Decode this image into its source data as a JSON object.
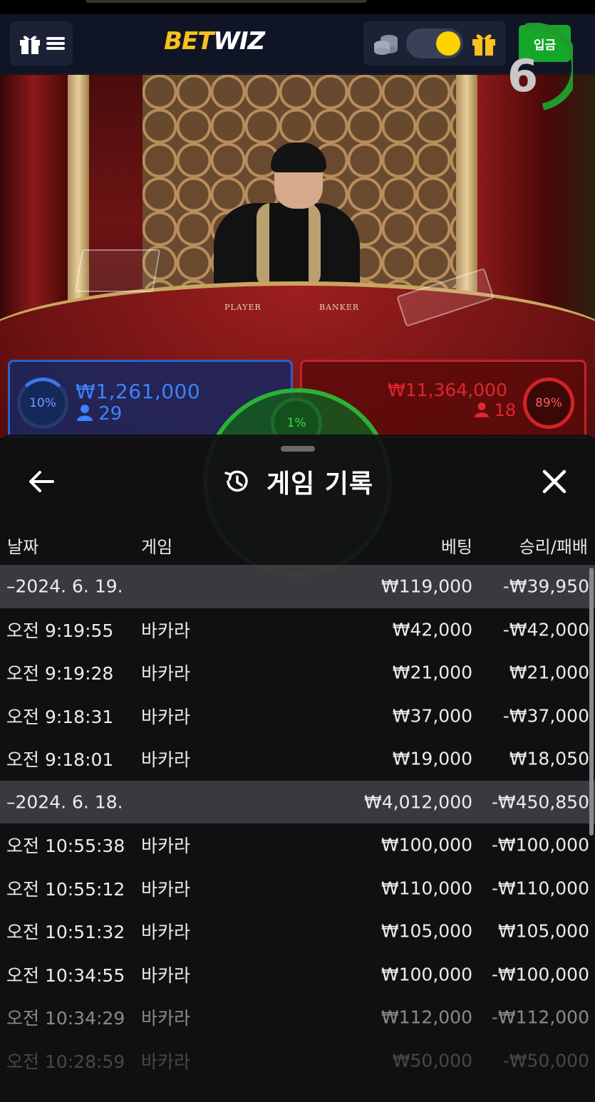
{
  "header": {
    "logo_part1": "BET",
    "logo_part2": "WIZ",
    "deposit_label": "입금"
  },
  "live": {
    "timer": "6",
    "player": {
      "percent": "10%",
      "amount": "₩1,261,000",
      "count": "29"
    },
    "tie": {
      "percent": "1%"
    },
    "banker": {
      "percent": "89%",
      "amount": "₩11,364,000",
      "count": "18"
    },
    "table_words": {
      "player": "PLAYER",
      "banker": "BANKER"
    }
  },
  "history": {
    "title": "게임 기록",
    "columns": {
      "date": "날짜",
      "game": "게임",
      "bet": "베팅",
      "win_loss": "승리/패배"
    },
    "groups": [
      {
        "date": "–2024. 6. 19.",
        "bet": "₩119,000",
        "result": "-₩39,950",
        "rows": [
          {
            "time": "오전 9:19:55",
            "game": "바카라",
            "bet": "₩42,000",
            "result": "-₩42,000"
          },
          {
            "time": "오전 9:19:28",
            "game": "바카라",
            "bet": "₩21,000",
            "result": "₩21,000"
          },
          {
            "time": "오전 9:18:31",
            "game": "바카라",
            "bet": "₩37,000",
            "result": "-₩37,000"
          },
          {
            "time": "오전 9:18:01",
            "game": "바카라",
            "bet": "₩19,000",
            "result": "₩18,050"
          }
        ]
      },
      {
        "date": "–2024. 6. 18.",
        "bet": "₩4,012,000",
        "result": "-₩450,850",
        "rows": [
          {
            "time": "오전 10:55:38",
            "game": "바카라",
            "bet": "₩100,000",
            "result": "-₩100,000"
          },
          {
            "time": "오전 10:55:12",
            "game": "바카라",
            "bet": "₩110,000",
            "result": "-₩110,000"
          },
          {
            "time": "오전 10:51:32",
            "game": "바카라",
            "bet": "₩105,000",
            "result": "₩105,000"
          },
          {
            "time": "오전 10:34:55",
            "game": "바카라",
            "bet": "₩100,000",
            "result": "-₩100,000"
          },
          {
            "time": "오전 10:34:29",
            "game": "바카라",
            "bet": "₩112,000",
            "result": "-₩112,000"
          },
          {
            "time": "오전 10:28:59",
            "game": "바카라",
            "bet": "₩50,000",
            "result": "-₩50,000"
          }
        ]
      }
    ]
  },
  "colors": {
    "brand_yellow": "#f7c21b",
    "deposit_green": "#14a72a",
    "player_blue": "#3c82ff",
    "banker_red": "#e0262c",
    "tie_green": "#2bb235"
  }
}
